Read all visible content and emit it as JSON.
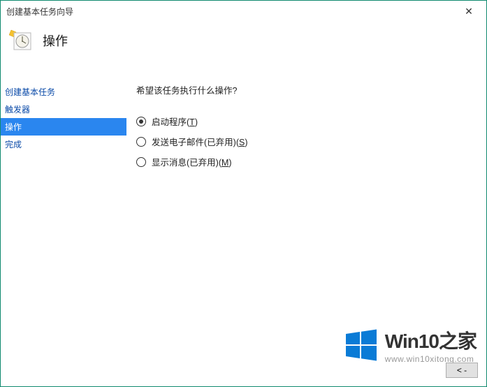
{
  "window": {
    "title": "创建基本任务向导"
  },
  "header": {
    "title": "操作"
  },
  "sidebar": {
    "items": [
      {
        "label": "创建基本任务",
        "selected": false
      },
      {
        "label": "触发器",
        "selected": false
      },
      {
        "label": "操作",
        "selected": true
      },
      {
        "label": "完成",
        "selected": false
      }
    ]
  },
  "main": {
    "prompt": "希望该任务执行什么操作?",
    "options": [
      {
        "label": "启动程序(T)",
        "hotkey": "T",
        "checked": true
      },
      {
        "label": "发送电子邮件(已弃用)(S)",
        "hotkey": "S",
        "checked": false
      },
      {
        "label": "显示消息(已弃用)(M)",
        "hotkey": "M",
        "checked": false
      }
    ]
  },
  "buttons": {
    "back": "< -"
  },
  "watermark": {
    "title": "Win10之家",
    "url": "www.win10xitong.com"
  }
}
